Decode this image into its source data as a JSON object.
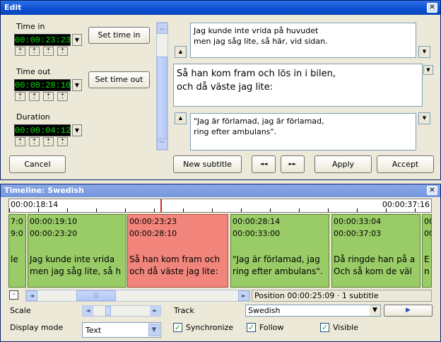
{
  "edit_window": {
    "title": "Edit",
    "time_in_label": "Time in",
    "time_in_value": "00:00:23:23",
    "set_time_in": "Set time in",
    "time_out_label": "Time out",
    "time_out_value": "00:00:28:10",
    "set_time_out": "Set time out",
    "duration_label": "Duration",
    "duration_value": "00:00:04:12",
    "cancel": "Cancel",
    "prev_subtitle_text": "Jag kunde inte vrida på huvudet\nmen jag såg lite, så här, vid sidan.",
    "current_subtitle_text": "Så han kom fram och lös in i bilen,\noch då väste jag lite:",
    "next_subtitle_text": "\"Jag är förlamad, jag är förlamad,\nring efter ambulans\".",
    "new_subtitle": "New subtitle",
    "rewind": "◄◄",
    "forward": "►►",
    "apply": "Apply",
    "accept": "Accept"
  },
  "timeline_window": {
    "title": "Timeline: Swedish",
    "ruler_start": "00:00:18:14",
    "ruler_end": "00:00:37:16",
    "blocks": [
      {
        "in": "7:0",
        "out": "9:0",
        "line1": "le",
        "line2": ""
      },
      {
        "in": "00:00:19:10",
        "out": "00:00:23:20",
        "line1": "Jag kunde inte vrida",
        "line2": "men jag såg lite, så h"
      },
      {
        "in": "00:00:23:23",
        "out": "00:00:28:10",
        "line1": "Så han kom fram och",
        "line2": "och då väste jag lite:"
      },
      {
        "in": "00:00:28:14",
        "out": "00:00:33:00",
        "line1": "\"Jag är förlamad, jag",
        "line2": "ring efter ambulans\"."
      },
      {
        "in": "00:00:33:04",
        "out": "00:00:37:03",
        "line1": "Då ringde han på a",
        "line2": "Och så kom de väl"
      },
      {
        "in": "00",
        "out": "00",
        "line1": "E",
        "line2": "n"
      }
    ],
    "position_text": "Position 00:00:25:09 · 1 subtitle",
    "scale_label": "Scale",
    "track_label": "Track",
    "track_value": "Swedish",
    "display_mode_label": "Display mode",
    "display_mode_value": "Text",
    "synchronize": "Synchronize",
    "follow": "Follow",
    "visible": "Visible"
  }
}
